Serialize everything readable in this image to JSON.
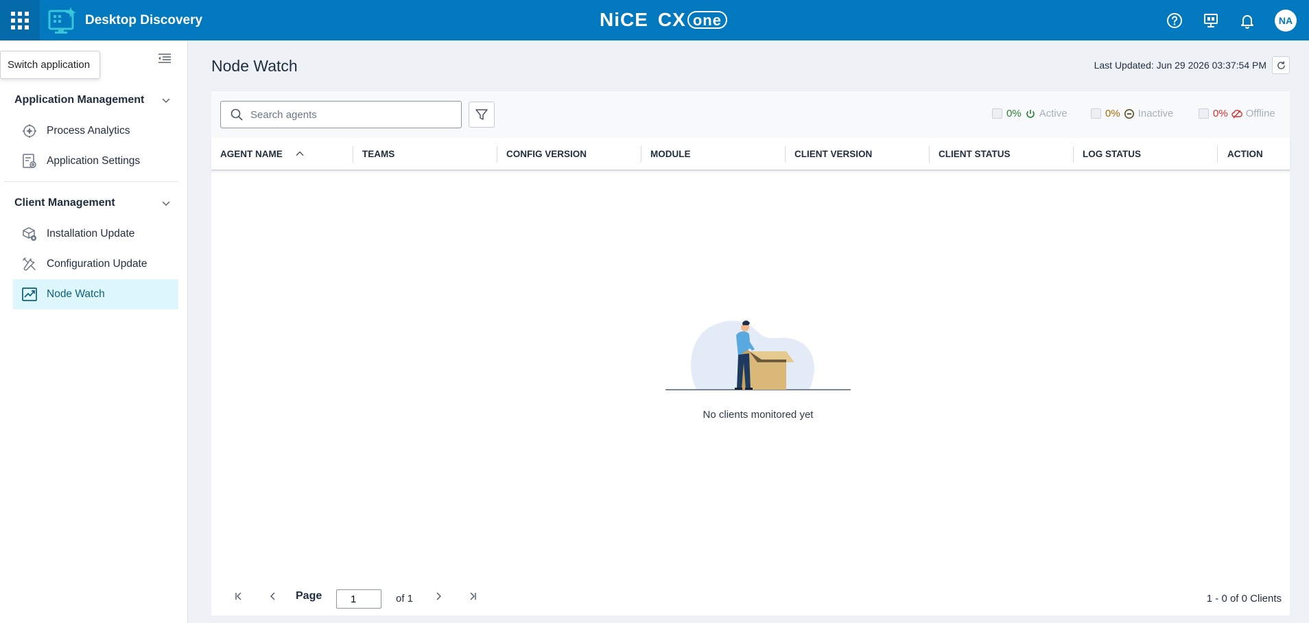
{
  "header": {
    "app_name": "Desktop Discovery",
    "brand_main": "NiCE",
    "brand_cx": "CX",
    "brand_one": "one",
    "avatar_initials": "NA",
    "colors": {
      "bar": "#0279be",
      "waffle_bg": "#046aa9"
    },
    "icons": [
      "waffle-icon",
      "help-icon",
      "presentation-icon",
      "bell-icon"
    ]
  },
  "sidebar": {
    "tooltip": "Switch application",
    "sections": [
      {
        "title": "Application Management",
        "items": [
          {
            "label": "Process Analytics",
            "icon": "process-analytics-icon"
          },
          {
            "label": "Application Settings",
            "icon": "application-settings-icon"
          }
        ]
      },
      {
        "title": "Client Management",
        "items": [
          {
            "label": "Installation Update",
            "icon": "installation-update-icon"
          },
          {
            "label": "Configuration Update",
            "icon": "configuration-update-icon"
          },
          {
            "label": "Node Watch",
            "icon": "node-watch-icon",
            "active": true
          }
        ]
      }
    ]
  },
  "main": {
    "title": "Node Watch",
    "last_updated": "Last Updated: Jun 29 2026 03:37:54 PM",
    "search": {
      "placeholder": "Search agents",
      "value": ""
    },
    "stats": [
      {
        "pct": "0%",
        "label": "Active",
        "color": "#2e7d32"
      },
      {
        "pct": "0%",
        "label": "Inactive",
        "color": "#a86b00"
      },
      {
        "pct": "0%",
        "label": "Offline",
        "color": "#d32f2f"
      }
    ],
    "columns": [
      "AGENT NAME",
      "TEAMS",
      "CONFIG VERSION",
      "MODULE",
      "CLIENT VERSION",
      "CLIENT STATUS",
      "LOG STATUS",
      "ACTION"
    ],
    "sort": {
      "column": "AGENT NAME",
      "direction": "ascending"
    },
    "empty_message": "No clients monitored yet",
    "pagination": {
      "page_label": "Page",
      "page_value": "1",
      "of_label": "of 1",
      "summary": "1 - 0 of 0 Clients"
    }
  }
}
